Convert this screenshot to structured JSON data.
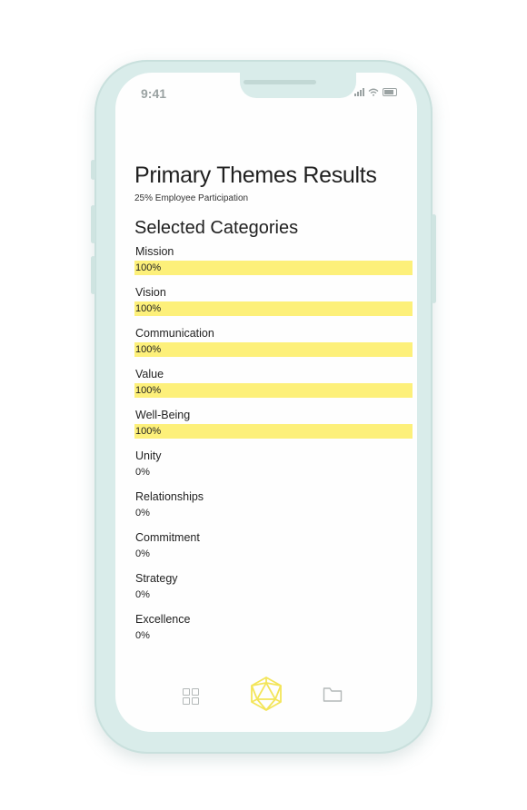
{
  "status": {
    "time": "9:41"
  },
  "page": {
    "title": "Primary Themes Results",
    "subtitle": "25% Employee Participation",
    "section_title": "Selected Categories"
  },
  "categories": [
    {
      "label": "Mission",
      "value_text": "100%",
      "fraction": 1.0
    },
    {
      "label": "Vision",
      "value_text": "100%",
      "fraction": 1.0
    },
    {
      "label": "Communication",
      "value_text": "100%",
      "fraction": 1.0
    },
    {
      "label": "Value",
      "value_text": "100%",
      "fraction": 1.0
    },
    {
      "label": "Well-Being",
      "value_text": "100%",
      "fraction": 1.0
    },
    {
      "label": "Unity",
      "value_text": "0%",
      "fraction": 0
    },
    {
      "label": "Relationships",
      "value_text": "0%",
      "fraction": 0
    },
    {
      "label": "Commitment",
      "value_text": "0%",
      "fraction": 0
    },
    {
      "label": "Strategy",
      "value_text": "0%",
      "fraction": 0
    },
    {
      "label": "Excellence",
      "value_text": "0%",
      "fraction": 0
    }
  ],
  "colors": {
    "bar_fill": "#fdf07a",
    "accent_gem": "#f3e55a",
    "tab_icon": "#b3b8b8",
    "phone_frame": "#d9ecea"
  },
  "tabbar": {
    "icons": [
      "grid-icon",
      "gem-icon",
      "folder-icon"
    ]
  }
}
